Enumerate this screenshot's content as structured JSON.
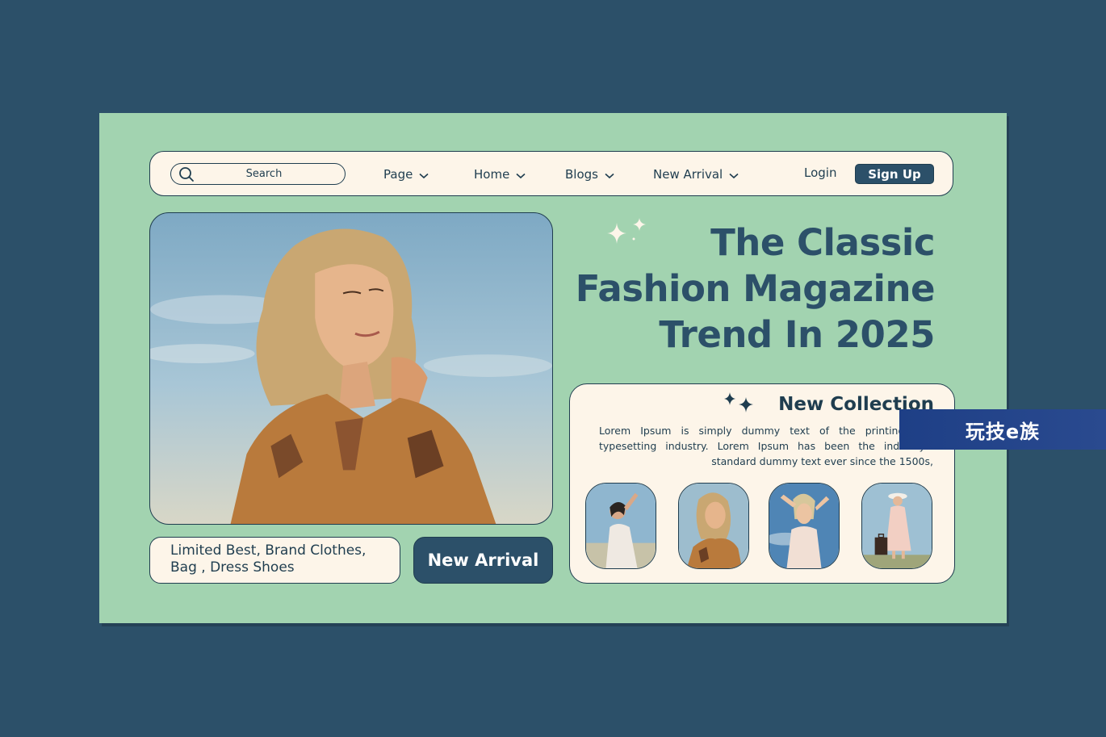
{
  "nav": {
    "search_placeholder": "Search",
    "items": [
      {
        "label": "Page"
      },
      {
        "label": "Home"
      },
      {
        "label": "Blogs"
      },
      {
        "label": "New Arrival"
      }
    ],
    "login_label": "Login",
    "signup_label": "Sign Up"
  },
  "hero": {
    "headline": [
      "The Classic",
      "Fashion Magazine",
      "Trend In 2025"
    ],
    "image_icon": "woman-portrait-photo"
  },
  "promo": {
    "tagline": "Limited Best, Brand Clothes, Bag , Dress  Shoes",
    "button_label": "New Arrival"
  },
  "collection": {
    "title": "New Collection",
    "description": "Lorem Ipsum is simply dummy text of the printing and typesetting industry. Lorem Ipsum has been the industry's standard dummy text ever since the 1500s,",
    "thumbnails": [
      {
        "icon": "woman-white-dress-photo"
      },
      {
        "icon": "woman-blonde-portrait-photo"
      },
      {
        "icon": "woman-sky-photo"
      },
      {
        "icon": "woman-with-suitcase-photo"
      }
    ]
  },
  "watermark": {
    "text": "玩技e族"
  },
  "colors": {
    "background": "#2c5069",
    "card": "#a2d3b0",
    "panel": "#fdf5e9",
    "accent": "#2c5069",
    "text": "#1f3d4f"
  }
}
